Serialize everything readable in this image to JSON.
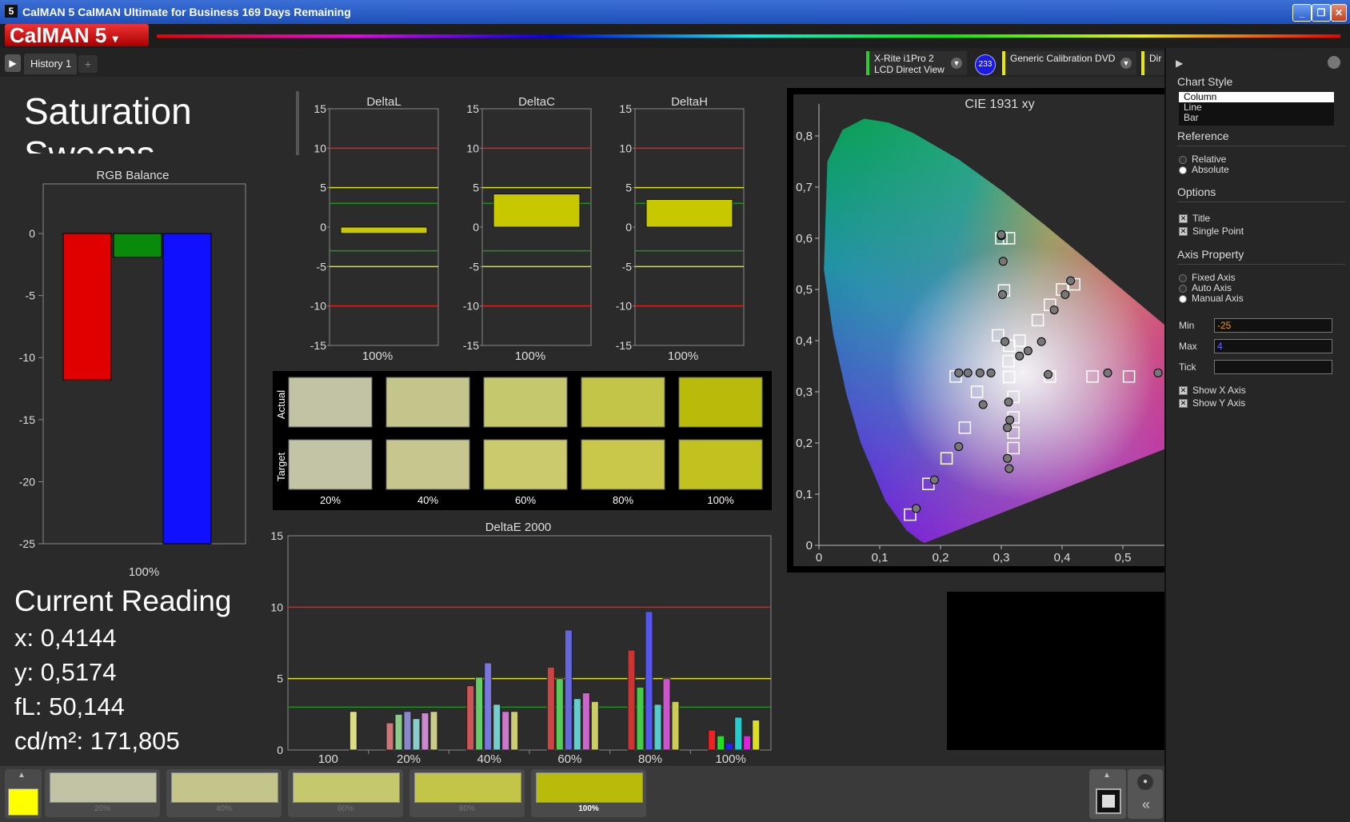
{
  "window": {
    "title": "CalMAN 5 CalMAN Ultimate for Business 169 Days Remaining",
    "app_icon": "5"
  },
  "logo": {
    "text": "CalMAN 5"
  },
  "tabs": [
    {
      "label": "History 1"
    }
  ],
  "devices": [
    {
      "line1": "X-Rite i1Pro 2",
      "line2": "LCD Direct View",
      "color": "#2ecc2e"
    },
    {
      "line1": "Generic Calibration DVD",
      "line2": "",
      "color": "#e8e800"
    },
    {
      "line1": "Dir",
      "line2": "",
      "color": "#e8e800"
    }
  ],
  "badge": "233",
  "page_title": "Saturation Sweeps",
  "rgb_balance": {
    "title": "RGB Balance",
    "xlabel": "100%",
    "yticks": [
      "0",
      "-5",
      "-10",
      "-15",
      "-20",
      "-25"
    ],
    "ylim": [
      -25,
      4
    ],
    "bars": [
      {
        "name": "red",
        "value": -11.8,
        "color": "#e00000"
      },
      {
        "name": "green",
        "value": -1.9,
        "color": "#0a8a0a"
      },
      {
        "name": "blue",
        "value": -25,
        "color": "#1010ff"
      }
    ]
  },
  "delta_charts": [
    {
      "title": "DeltaL",
      "xlabel": "100%",
      "value": -0.8
    },
    {
      "title": "DeltaC",
      "xlabel": "100%",
      "value": 4.2
    },
    {
      "title": "DeltaH",
      "xlabel": "100%",
      "value": 3.5
    }
  ],
  "delta_yticks": [
    "15",
    "10",
    "5",
    "0",
    "-5",
    "-10",
    "-15"
  ],
  "swatches": {
    "row_labels": [
      "Actual",
      "Target"
    ],
    "labels": [
      "20%",
      "40%",
      "60%",
      "80%",
      "100%"
    ],
    "actual": [
      "#c1c3a4",
      "#c3c58a",
      "#c6c86e",
      "#c2c548",
      "#b8bb0a"
    ],
    "target": [
      "#c3c4a6",
      "#c7c68e",
      "#cbca6c",
      "#c9c84a",
      "#c1c120"
    ]
  },
  "deltae": {
    "title": "DeltaE 2000",
    "yticks": [
      "15",
      "10",
      "5",
      "0"
    ],
    "categories": [
      "100",
      "20%",
      "40%",
      "60%",
      "80%",
      "100%"
    ],
    "ylim": [
      0,
      15
    ],
    "groups": [
      {
        "values": [
          0,
          0,
          0,
          0,
          0,
          2.7
        ],
        "colors": [
          "#c44",
          "#5c5",
          "#77d",
          "#7cc",
          "#c7c",
          "#dd8"
        ]
      },
      {
        "values": [
          1.9,
          2.5,
          2.7,
          2.2,
          2.6,
          2.7
        ],
        "colors": [
          "#c77",
          "#8c8",
          "#88c",
          "#8cc",
          "#c8c",
          "#cc8"
        ]
      },
      {
        "values": [
          4.5,
          5.1,
          6.1,
          3.2,
          2.7,
          2.7
        ],
        "colors": [
          "#c55",
          "#6c6",
          "#77d",
          "#7cc",
          "#c7c",
          "#cc7"
        ]
      },
      {
        "values": [
          5.8,
          5.0,
          8.4,
          3.6,
          4.0,
          3.4
        ],
        "colors": [
          "#c44",
          "#5c5",
          "#66d",
          "#6cc",
          "#c6c",
          "#cc6"
        ]
      },
      {
        "values": [
          7.0,
          4.4,
          9.7,
          3.2,
          5.0,
          3.4
        ],
        "colors": [
          "#c33",
          "#4c4",
          "#55e",
          "#5cc",
          "#c5c",
          "#cc5"
        ]
      },
      {
        "values": [
          1.4,
          1.0,
          0.5,
          2.3,
          1.0,
          2.1
        ],
        "colors": [
          "#e22",
          "#2d2",
          "#22e",
          "#2cc",
          "#d2d",
          "#dd2"
        ]
      }
    ],
    "thresholds": [
      {
        "value": 10,
        "color": "#e02020"
      },
      {
        "value": 5,
        "color": "#e0e020"
      },
      {
        "value": 3,
        "color": "#209020"
      }
    ]
  },
  "reading": {
    "title": "Current Reading",
    "x": "x: 0,4144",
    "y": "y: 0,5174",
    "fl": "fL: 50,144",
    "cdm2": "cd/m²: 171,805"
  },
  "cie": {
    "title": "CIE 1931 xy",
    "xticks": [
      "0",
      "0,1",
      "0,2",
      "0,3",
      "0,4",
      "0,5"
    ],
    "yticks": [
      "0",
      "0,1",
      "0,2",
      "0,3",
      "0,4",
      "0,5",
      "0,6",
      "0,7",
      "0,8"
    ],
    "targets": [
      [
        0.3127,
        0.329
      ],
      [
        0.2946,
        0.4104
      ],
      [
        0.3045,
        0.4981
      ],
      [
        0.3127,
        0.329
      ],
      [
        0.312,
        0.36
      ],
      [
        0.313,
        0.39
      ],
      [
        0.32,
        0.29
      ],
      [
        0.32,
        0.25
      ],
      [
        0.32,
        0.22
      ],
      [
        0.32,
        0.19
      ],
      [
        0.3127,
        0.6
      ],
      [
        0.3,
        0.6
      ],
      [
        0.26,
        0.3
      ],
      [
        0.24,
        0.23
      ],
      [
        0.21,
        0.17
      ],
      [
        0.18,
        0.12
      ],
      [
        0.15,
        0.06
      ],
      [
        0.38,
        0.33
      ],
      [
        0.45,
        0.33
      ],
      [
        0.51,
        0.33
      ],
      [
        0.33,
        0.4
      ],
      [
        0.36,
        0.44
      ],
      [
        0.38,
        0.47
      ],
      [
        0.4,
        0.5
      ],
      [
        0.42,
        0.51
      ],
      [
        0.225,
        0.33
      ]
    ],
    "measured": [
      [
        0.3,
        0.605
      ],
      [
        0.303,
        0.555
      ],
      [
        0.302,
        0.49
      ],
      [
        0.306,
        0.398
      ],
      [
        0.33,
        0.37
      ],
      [
        0.344,
        0.38
      ],
      [
        0.366,
        0.398
      ],
      [
        0.387,
        0.46
      ],
      [
        0.405,
        0.49
      ],
      [
        0.414,
        0.517
      ],
      [
        0.31,
        0.23
      ],
      [
        0.312,
        0.28
      ],
      [
        0.314,
        0.245
      ],
      [
        0.31,
        0.17
      ],
      [
        0.313,
        0.15
      ],
      [
        0.27,
        0.275
      ],
      [
        0.23,
        0.193
      ],
      [
        0.19,
        0.128
      ],
      [
        0.16,
        0.072
      ],
      [
        0.23,
        0.337
      ],
      [
        0.245,
        0.337
      ],
      [
        0.265,
        0.337
      ],
      [
        0.283,
        0.337
      ],
      [
        0.377,
        0.334
      ],
      [
        0.475,
        0.337
      ],
      [
        0.558,
        0.337
      ],
      [
        0.3,
        0.607
      ]
    ]
  },
  "sidebar": {
    "chart_style_label": "Chart Style",
    "chart_styles": [
      "Column",
      "Line",
      "Bar"
    ],
    "reference_label": "Reference",
    "reference_options": [
      "Relative",
      "Absolute"
    ],
    "options_label": "Options",
    "option_items": [
      "Title",
      "Single Point"
    ],
    "axis_label": "Axis Property",
    "axis_options": [
      "Fixed Axis",
      "Auto Axis",
      "Manual Axis"
    ],
    "min_label": "Min",
    "min_value": "-25",
    "max_label": "Max",
    "max_value": "4",
    "tick_label": "Tick",
    "tick_value": "",
    "show_items": [
      "Show X Axis",
      "Show Y Axis"
    ]
  },
  "bottom_swatches": [
    {
      "label": "20%",
      "color": "#c1c3a4"
    },
    {
      "label": "40%",
      "color": "#c3c58a"
    },
    {
      "label": "60%",
      "color": "#c6c86e"
    },
    {
      "label": "80%",
      "color": "#c2c548"
    },
    {
      "label": "100%",
      "color": "#b8bb0a"
    }
  ],
  "current_color": "#ffff00"
}
